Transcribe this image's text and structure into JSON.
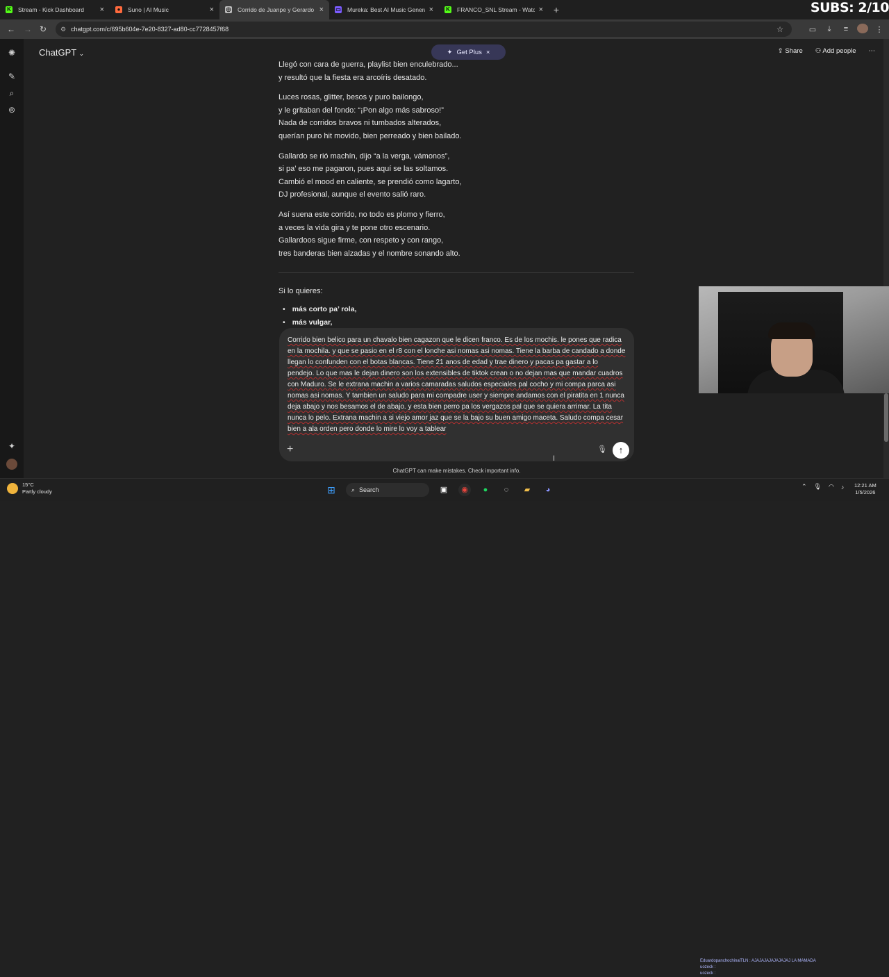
{
  "browser": {
    "tabs": [
      {
        "title": "Stream - Kick Dashboard",
        "color": "#53fc18",
        "glyph": "K",
        "active": false
      },
      {
        "title": "Suno | AI Music",
        "color": "#ff6a3d",
        "glyph": "●",
        "active": false
      },
      {
        "title": "Corrido de Juanpe y Gerardo",
        "color": "#bdbdbd",
        "glyph": "◎",
        "active": true
      },
      {
        "title": "Mureka: Best AI Music Generat",
        "color": "#7b5cff",
        "glyph": "▭",
        "active": false
      },
      {
        "title": "FRANCO_SNL Stream - Watch L",
        "color": "#53fc18",
        "glyph": "K",
        "active": false
      }
    ],
    "url": "chatgpt.com/c/695b604e-7e20-8327-ad80-cc7728457f68",
    "overlay_subs": "SUBS: 2/10"
  },
  "header": {
    "model": "ChatGPT",
    "get_plus": "Get Plus",
    "share": "Share",
    "add_people": "Add people"
  },
  "lyrics": [
    [
      "Llegó con cara de guerra, playlist bien enculebrado...",
      "y resultó que la fiesta era arcoíris desatado."
    ],
    [
      "Luces rosas, glitter, besos y puro bailongo,",
      "y le gritaban del fondo: “¡Pon algo más sabroso!”",
      "Nada de corridos bravos ni tumbados alterados,",
      "querían puro hit movido, bien perreado y bien bailado."
    ],
    [
      "Gallardo se rió machín, dijo “a la verga, vámonos”,",
      "si pa’ eso me pagaron, pues aquí se las soltamos.",
      "Cambió el mood en caliente, se prendió como lagarto,",
      "DJ profesional, aunque el evento salió raro."
    ],
    [
      "Así suena este corrido, no todo es plomo y fierro,",
      "a veces la vida gira y te pone otro escenario.",
      "Gallardoos sigue firme, con respeto y con rango,",
      "tres banderas bien alzadas y el nombre sonando alto."
    ]
  ],
  "offer": {
    "intro": "Si lo quieres:",
    "bullets": [
      "más corto pa’ rola,",
      "más vulgar,"
    ]
  },
  "composer": {
    "text": "Corrido bien belico para un chavalo bien cagazon que le dicen franco. Es de los mochis. le pones que radica en la mochila. y que se pasio en el r8 con el lonche asi nomas asi nomas. Tiene la barba de candado a donde llegan lo confunden con el botas blancas.  Tiene 21 anos de edad y trae dinero y pacas pa gastar a lo pendejo. Lo que mas le dejan dinero son los extensibles de tiktok crean o no dejan mas que mandar cuadros con Maduro.  Se le extrana machin a varios camaradas saludos especiales pal cocho y mi compa parca asi nomas asi nomas. Y tambien un saludo para mi compadre user y siempre andamos con el piratita en 1 nunca deja abajo y nos besamos el de abajo. y esta bien perro pa los vergazos pal que se quiera arrimar. La tita nunca lo pelo. Extrana machin a si viejo amor jaz que se la bajo su buen amigo maceta. Saludo compa cesar bien a ala orden pero donde lo mire lo voy a tablear",
    "disclaimer": "ChatGPT can make mistakes. Check important info."
  },
  "taskbar": {
    "temp": "15°C",
    "condition": "Partly cloudy",
    "search": "Search",
    "time": "12:21 AM",
    "date": "1/5/2026",
    "chat_line1": "EduardopanchochinalTLN : AJAJAJAJAJAJAJAJ LA MAMADA",
    "chat_line2": "uozeck :",
    "chat_line3": "uozeck :"
  }
}
